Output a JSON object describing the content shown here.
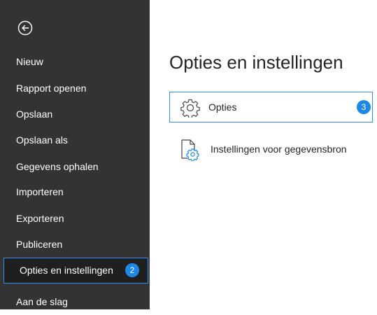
{
  "sidebar": {
    "back_icon": "back-arrow-circle-icon",
    "items": [
      {
        "label": "Nieuw"
      },
      {
        "label": "Rapport openen"
      },
      {
        "label": "Opslaan"
      },
      {
        "label": "Opslaan als"
      },
      {
        "label": "Gegevens ophalen"
      },
      {
        "label": "Importeren"
      },
      {
        "label": "Exporteren"
      },
      {
        "label": "Publiceren"
      },
      {
        "label": "Opties en instellingen",
        "badge": "2",
        "active": true
      },
      {
        "label": "Aan de slag"
      }
    ]
  },
  "main": {
    "title": "Opties en instellingen",
    "options": [
      {
        "label": "Opties",
        "icon": "gear-icon",
        "badge": "3",
        "selected": true
      },
      {
        "label": "Instellingen voor gegevensbron",
        "icon": "document-settings-icon"
      }
    ]
  },
  "colors": {
    "sidebar_bg": "#333333",
    "accent": "#2f8ef0",
    "badge": "#1e88e5"
  }
}
